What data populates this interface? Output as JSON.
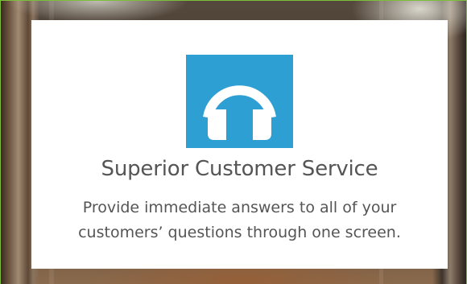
{
  "card": {
    "icon": "headphones-icon",
    "icon_bg_color": "#2e9fd3",
    "title": "Superior Customer Service",
    "description_line1": "Provide immediate answers to all of your",
    "description_line2": "customers’ questions through one screen."
  },
  "colors": {
    "accent_border": "#7cbf3a",
    "text": "#555555"
  }
}
